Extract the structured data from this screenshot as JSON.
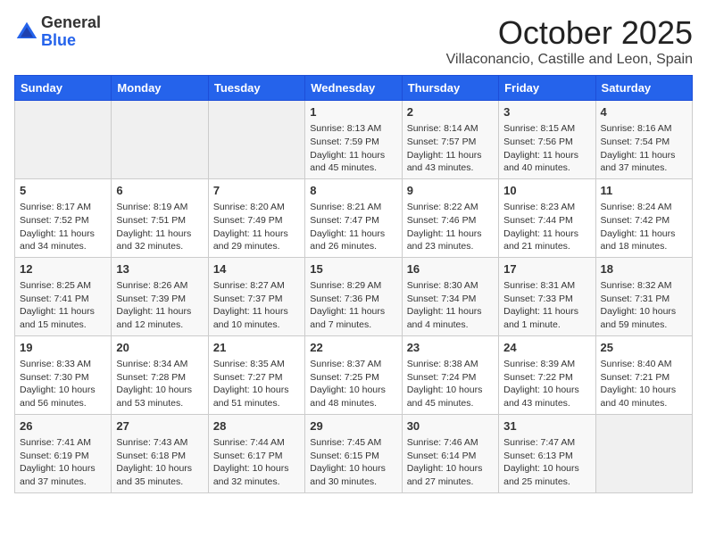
{
  "logo": {
    "general": "General",
    "blue": "Blue"
  },
  "header": {
    "month": "October 2025",
    "location": "Villaconancio, Castille and Leon, Spain"
  },
  "weekdays": [
    "Sunday",
    "Monday",
    "Tuesday",
    "Wednesday",
    "Thursday",
    "Friday",
    "Saturday"
  ],
  "weeks": [
    [
      {
        "day": "",
        "info": ""
      },
      {
        "day": "",
        "info": ""
      },
      {
        "day": "",
        "info": ""
      },
      {
        "day": "1",
        "info": "Sunrise: 8:13 AM\nSunset: 7:59 PM\nDaylight: 11 hours and 45 minutes."
      },
      {
        "day": "2",
        "info": "Sunrise: 8:14 AM\nSunset: 7:57 PM\nDaylight: 11 hours and 43 minutes."
      },
      {
        "day": "3",
        "info": "Sunrise: 8:15 AM\nSunset: 7:56 PM\nDaylight: 11 hours and 40 minutes."
      },
      {
        "day": "4",
        "info": "Sunrise: 8:16 AM\nSunset: 7:54 PM\nDaylight: 11 hours and 37 minutes."
      }
    ],
    [
      {
        "day": "5",
        "info": "Sunrise: 8:17 AM\nSunset: 7:52 PM\nDaylight: 11 hours and 34 minutes."
      },
      {
        "day": "6",
        "info": "Sunrise: 8:19 AM\nSunset: 7:51 PM\nDaylight: 11 hours and 32 minutes."
      },
      {
        "day": "7",
        "info": "Sunrise: 8:20 AM\nSunset: 7:49 PM\nDaylight: 11 hours and 29 minutes."
      },
      {
        "day": "8",
        "info": "Sunrise: 8:21 AM\nSunset: 7:47 PM\nDaylight: 11 hours and 26 minutes."
      },
      {
        "day": "9",
        "info": "Sunrise: 8:22 AM\nSunset: 7:46 PM\nDaylight: 11 hours and 23 minutes."
      },
      {
        "day": "10",
        "info": "Sunrise: 8:23 AM\nSunset: 7:44 PM\nDaylight: 11 hours and 21 minutes."
      },
      {
        "day": "11",
        "info": "Sunrise: 8:24 AM\nSunset: 7:42 PM\nDaylight: 11 hours and 18 minutes."
      }
    ],
    [
      {
        "day": "12",
        "info": "Sunrise: 8:25 AM\nSunset: 7:41 PM\nDaylight: 11 hours and 15 minutes."
      },
      {
        "day": "13",
        "info": "Sunrise: 8:26 AM\nSunset: 7:39 PM\nDaylight: 11 hours and 12 minutes."
      },
      {
        "day": "14",
        "info": "Sunrise: 8:27 AM\nSunset: 7:37 PM\nDaylight: 11 hours and 10 minutes."
      },
      {
        "day": "15",
        "info": "Sunrise: 8:29 AM\nSunset: 7:36 PM\nDaylight: 11 hours and 7 minutes."
      },
      {
        "day": "16",
        "info": "Sunrise: 8:30 AM\nSunset: 7:34 PM\nDaylight: 11 hours and 4 minutes."
      },
      {
        "day": "17",
        "info": "Sunrise: 8:31 AM\nSunset: 7:33 PM\nDaylight: 11 hours and 1 minute."
      },
      {
        "day": "18",
        "info": "Sunrise: 8:32 AM\nSunset: 7:31 PM\nDaylight: 10 hours and 59 minutes."
      }
    ],
    [
      {
        "day": "19",
        "info": "Sunrise: 8:33 AM\nSunset: 7:30 PM\nDaylight: 10 hours and 56 minutes."
      },
      {
        "day": "20",
        "info": "Sunrise: 8:34 AM\nSunset: 7:28 PM\nDaylight: 10 hours and 53 minutes."
      },
      {
        "day": "21",
        "info": "Sunrise: 8:35 AM\nSunset: 7:27 PM\nDaylight: 10 hours and 51 minutes."
      },
      {
        "day": "22",
        "info": "Sunrise: 8:37 AM\nSunset: 7:25 PM\nDaylight: 10 hours and 48 minutes."
      },
      {
        "day": "23",
        "info": "Sunrise: 8:38 AM\nSunset: 7:24 PM\nDaylight: 10 hours and 45 minutes."
      },
      {
        "day": "24",
        "info": "Sunrise: 8:39 AM\nSunset: 7:22 PM\nDaylight: 10 hours and 43 minutes."
      },
      {
        "day": "25",
        "info": "Sunrise: 8:40 AM\nSunset: 7:21 PM\nDaylight: 10 hours and 40 minutes."
      }
    ],
    [
      {
        "day": "26",
        "info": "Sunrise: 7:41 AM\nSunset: 6:19 PM\nDaylight: 10 hours and 37 minutes."
      },
      {
        "day": "27",
        "info": "Sunrise: 7:43 AM\nSunset: 6:18 PM\nDaylight: 10 hours and 35 minutes."
      },
      {
        "day": "28",
        "info": "Sunrise: 7:44 AM\nSunset: 6:17 PM\nDaylight: 10 hours and 32 minutes."
      },
      {
        "day": "29",
        "info": "Sunrise: 7:45 AM\nSunset: 6:15 PM\nDaylight: 10 hours and 30 minutes."
      },
      {
        "day": "30",
        "info": "Sunrise: 7:46 AM\nSunset: 6:14 PM\nDaylight: 10 hours and 27 minutes."
      },
      {
        "day": "31",
        "info": "Sunrise: 7:47 AM\nSunset: 6:13 PM\nDaylight: 10 hours and 25 minutes."
      },
      {
        "day": "",
        "info": ""
      }
    ]
  ]
}
